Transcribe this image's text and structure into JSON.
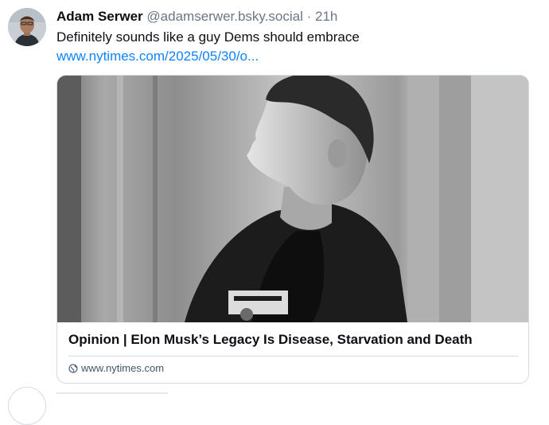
{
  "post": {
    "author_name": "Adam Serwer",
    "author_handle": "@adamserwer.bsky.social",
    "separator": "·",
    "timestamp": "21h",
    "text": "Definitely sounds like a guy Dems should embrace",
    "link_text": "www.nytimes.com/2025/05/30/o..."
  },
  "link_card": {
    "title": "Opinion | Elon Musk’s Legacy Is Disease, Starvation and Death",
    "domain": "www.nytimes.com"
  },
  "colors": {
    "link": "#1083fe",
    "secondary_text": "#6b7784",
    "border": "#d4dbe2"
  },
  "icons": {
    "domain": "globe-icon"
  }
}
